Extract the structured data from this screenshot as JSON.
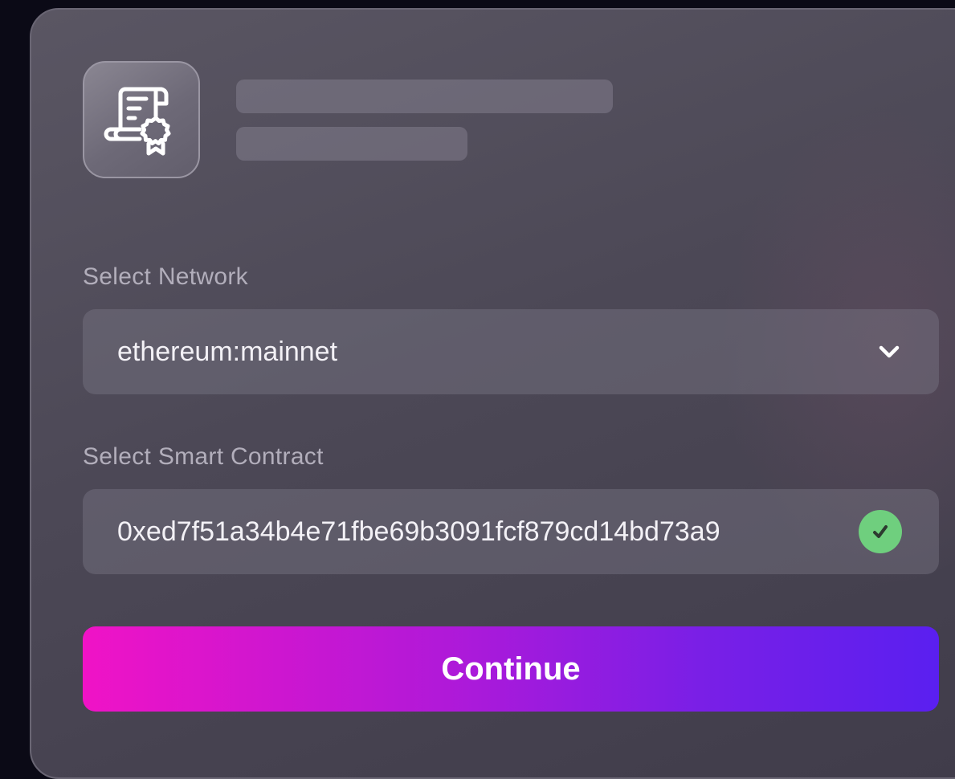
{
  "form": {
    "network_label": "Select Network",
    "network_value": "ethereum:mainnet",
    "contract_label": "Select Smart Contract",
    "contract_value": "0xed7f51a34b4e71fbe69b3091fcf879cd14bd73a9",
    "continue_label": "Continue"
  },
  "icons": {
    "header": "certificate-scroll-icon",
    "network_dropdown": "chevron-down-icon",
    "contract_status": "check-circle-icon"
  },
  "colors": {
    "background": "#0b0a16",
    "check": "#6fcf7e",
    "button_gradient_start": "#f013c6",
    "button_gradient_end": "#5a1ff0"
  }
}
